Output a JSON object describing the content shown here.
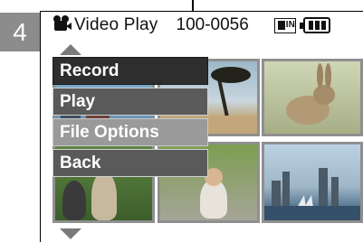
{
  "step_number": "4",
  "header": {
    "title": "Video Play",
    "file_number": "100-0056",
    "mode_icon": "video-play-icon",
    "memory_icon": "memory-card-icon",
    "memory_label": "IN",
    "battery_icon": "battery-icon"
  },
  "menu": {
    "items": [
      {
        "label": "Record"
      },
      {
        "label": "Play"
      },
      {
        "label": "File Options"
      },
      {
        "label": "Back"
      }
    ],
    "selected_index": 2
  },
  "thumbnails": [
    {
      "scene": "family-photo"
    },
    {
      "scene": "tropical-beach"
    },
    {
      "scene": "rabbit"
    },
    {
      "scene": "children-outdoors"
    },
    {
      "scene": "baby-on-grass"
    },
    {
      "scene": "city-skyline"
    }
  ],
  "colors": {
    "badge": "#8c8c8c",
    "menu_item": "#5a5a5a",
    "menu_selected": "#9a9a9a",
    "arrow": "#7a7a7a"
  }
}
